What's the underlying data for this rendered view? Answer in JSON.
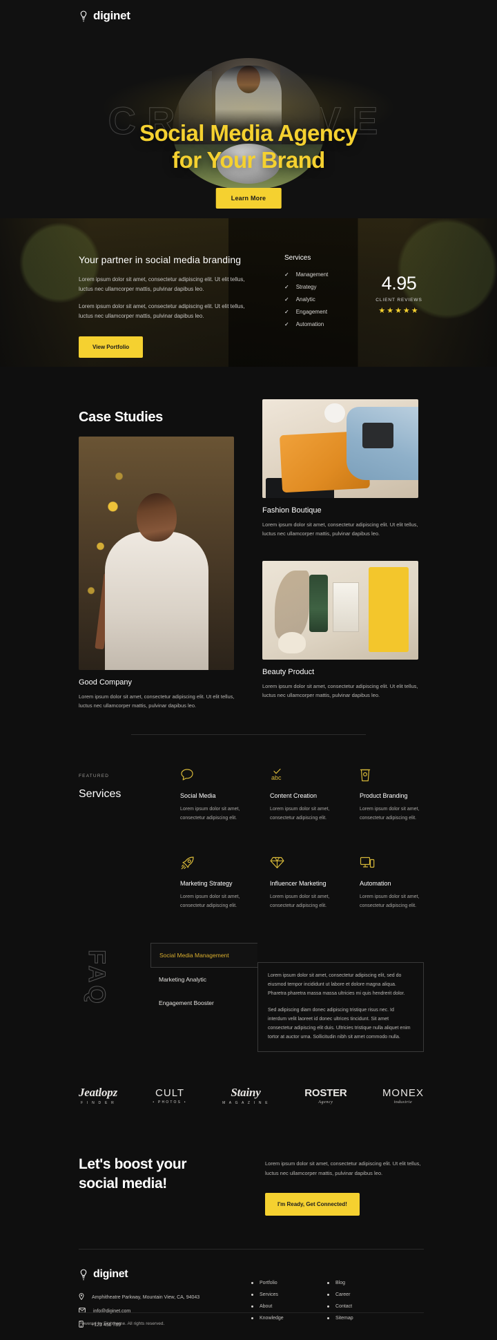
{
  "brand": {
    "name": "diginet",
    "icon": "lightbulb-icon"
  },
  "hero": {
    "backdrop_word": "CREATIVE",
    "title_line1": "Social Media Agency",
    "title_line2": "for Your Brand",
    "cta_label": "Learn More",
    "accent": "#f5d130"
  },
  "partner": {
    "title": "Your partner in social media branding",
    "paragraph1": "Lorem ipsum dolor sit amet, consectetur adipiscing elit. Ut elit tellus, luctus nec ullamcorper mattis, pulvinar dapibus leo.",
    "paragraph2": "Lorem ipsum dolor sit amet, consectetur adipiscing elit. Ut elit tellus, luctus nec ullamcorper mattis, pulvinar dapibus leo.",
    "button_label": "View Portfolio",
    "services_heading": "Services",
    "services": [
      "Management",
      "Strategy",
      "Analytic",
      "Engagement",
      "Automation"
    ],
    "rating_value": "4.95",
    "rating_label": "CLIENT REVIEWS",
    "rating_stars": "★★★★★"
  },
  "case_studies": {
    "heading": "Case Studies",
    "items": [
      {
        "title": "Good Company",
        "text": "Lorem ipsum dolor sit amet, consectetur adipiscing elit. Ut elit tellus, luctus nec ullamcorper mattis, pulvinar dapibus leo."
      },
      {
        "title": "Fashion Boutique",
        "text": "Lorem ipsum dolor sit amet, consectetur adipiscing elit. Ut elit tellus, luctus nec ullamcorper mattis, pulvinar dapibus leo."
      },
      {
        "title": "Beauty Product",
        "text": "Lorem ipsum dolor sit amet, consectetur adipiscing elit. Ut elit tellus, luctus nec ullamcorper mattis, pulvinar dapibus leo."
      }
    ]
  },
  "featured": {
    "kicker": "FEATURED",
    "heading": "Services",
    "items": [
      {
        "icon": "speech-bubble-icon",
        "title": "Social Media",
        "text": "Lorem ipsum dolor sit amet, consectetur adipiscing elit."
      },
      {
        "icon": "abc-check-icon",
        "title": "Content Creation",
        "text": "Lorem ipsum dolor sit amet, consectetur adipiscing elit."
      },
      {
        "icon": "coffee-cup-icon",
        "title": "Product Branding",
        "text": "Lorem ipsum dolor sit amet, consectetur adipiscing elit."
      },
      {
        "icon": "rocket-icon",
        "title": "Marketing Strategy",
        "text": "Lorem ipsum dolor sit amet, consectetur adipiscing elit."
      },
      {
        "icon": "diamond-icon",
        "title": "Influencer Marketing",
        "text": "Lorem ipsum dolor sit amet, consectetur adipiscing elit."
      },
      {
        "icon": "devices-icon",
        "title": "Automation",
        "text": "Lorem ipsum dolor sit amet, consectetur adipiscing elit."
      }
    ]
  },
  "faq": {
    "side_word": "FAQ",
    "tabs": [
      "Social Media Management",
      "Marketing Analytic",
      "Engagement Booster"
    ],
    "active_tab": "Social Media Management",
    "body_p1": "Lorem ipsum dolor sit amet, consectetur adipiscing elit, sed do eiusmod tempor incididunt ut labore et dolore magna aliqua. Pharetra pharetra massa massa ultricies mi quis hendrerit dolor.",
    "body_p2": "Sed adipiscing diam donec adipiscing tristique risus nec. Id interdum velit laoreet id donec ultrices tincidunt. Sit amet consectetur adipiscing elit duis. Ultricies tristique nulla aliquet enim tortor at auctor urna. Sollicitudin nibh sit amet commodo nulla."
  },
  "logos": [
    {
      "name": "Jeatlopz",
      "sub": "F I N D E R"
    },
    {
      "name": "CULT",
      "sub": "• PHOTOS •"
    },
    {
      "name": "Stainy",
      "sub": "M A G A Z I N E"
    },
    {
      "name": "ROSTER",
      "sub": "Agency"
    },
    {
      "name": "MONEX",
      "sub": "industrie"
    }
  ],
  "cta": {
    "heading_line1": "Let's boost your",
    "heading_line2": "social media!",
    "text": "Lorem ipsum dolor sit amet, consectetur adipiscing elit. Ut elit tellus, luctus nec ullamcorper mattis, pulvinar dapibus leo.",
    "button_label": "I'm Ready, Get Connected!"
  },
  "footer": {
    "brand": "diginet",
    "address": "Amphitheatre Parkway, Mountain View, CA, 94043",
    "email": "info@diginet.com",
    "phone": "+123 456 789",
    "col1": [
      "Portfolio",
      "Services",
      "About",
      "Knowledge"
    ],
    "col2": [
      "Blog",
      "Career",
      "Contact",
      "Sitemap"
    ],
    "copyright": "Powered by Eightheme. All rights reserved."
  }
}
